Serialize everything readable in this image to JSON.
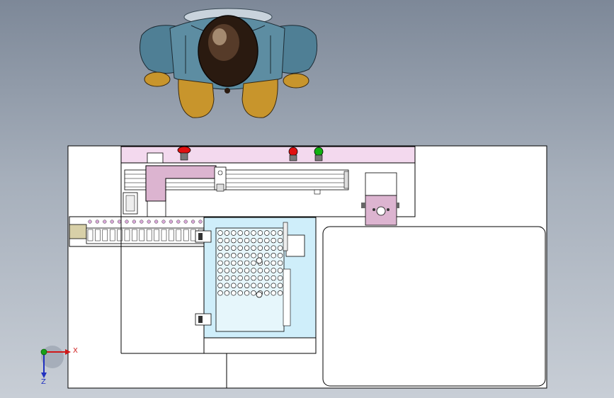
{
  "triad": {
    "x_label": "X",
    "z_label": "Z",
    "x_color": "#d01818",
    "y_color": "#18a018",
    "z_color": "#2030c0"
  },
  "colors": {
    "panel_pink": "#f3d9ee",
    "gantry_pink": "#dcb4d0",
    "tray_blue": "#cfeefa",
    "button_red": "#e01010",
    "button_green": "#10b010",
    "sheet_white": "#ffffff",
    "figure_blue": "#4f7f95",
    "figure_gold": "#c8952c"
  },
  "buttons": [
    {
      "name": "emergency-stop-button",
      "color": "red"
    },
    {
      "name": "stop-button",
      "color": "red"
    },
    {
      "name": "start-button",
      "color": "green"
    }
  ],
  "icons": [
    "human-figure-icon",
    "coordinate-triad-icon",
    "signal-tower-icon"
  ],
  "tray": {
    "rows": 9,
    "cols": 10
  },
  "feeder": {
    "positions": 16
  }
}
